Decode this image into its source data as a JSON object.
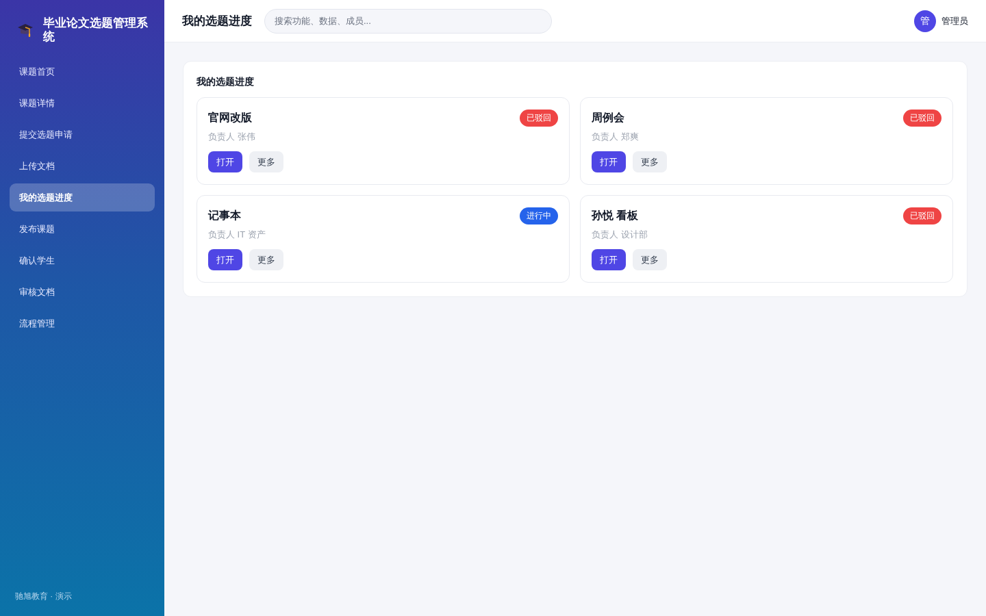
{
  "sidebar": {
    "app_title": "毕业论文选题管理系统",
    "items": [
      {
        "label": "课题首页",
        "selected": false
      },
      {
        "label": "课题详情",
        "selected": false
      },
      {
        "label": "提交选题申请",
        "selected": false
      },
      {
        "label": "上传文档",
        "selected": false
      },
      {
        "label": "我的选题进度",
        "selected": true
      },
      {
        "label": "发布课题",
        "selected": false
      },
      {
        "label": "确认学生",
        "selected": false
      },
      {
        "label": "审核文档",
        "selected": false
      },
      {
        "label": "流程管理",
        "selected": false
      }
    ],
    "footer": "驰旭教育 · 演示"
  },
  "header": {
    "title": "我的选题进度",
    "search": {
      "placeholder": "搜索功能、数据、成员..."
    },
    "user": {
      "avatar_text": "管",
      "name": "管理员"
    }
  },
  "panel": {
    "title": "我的选题进度",
    "cards": [
      {
        "title": "官网改版",
        "status": {
          "label": "已驳回",
          "color": "#ef4444"
        },
        "owner": "负责人 张伟",
        "buttons": [
          {
            "label": "打开",
            "kind": "primary"
          },
          {
            "label": "更多",
            "kind": "secondary"
          }
        ]
      },
      {
        "title": "周例会",
        "status": {
          "label": "已驳回",
          "color": "#ef4444"
        },
        "owner": "负责人 郑爽",
        "buttons": [
          {
            "label": "打开",
            "kind": "primary"
          },
          {
            "label": "更多",
            "kind": "secondary"
          }
        ]
      },
      {
        "title": "记事本",
        "status": {
          "label": "进行中",
          "color": "#2563eb"
        },
        "owner": "负责人 IT 资产",
        "buttons": [
          {
            "label": "打开",
            "kind": "primary"
          },
          {
            "label": "更多",
            "kind": "secondary"
          }
        ]
      },
      {
        "title": "孙悦 看板",
        "status": {
          "label": "已驳回",
          "color": "#ef4444"
        },
        "owner": "负责人 设计部",
        "buttons": [
          {
            "label": "打开",
            "kind": "primary"
          },
          {
            "label": "更多",
            "kind": "secondary"
          }
        ]
      }
    ]
  }
}
